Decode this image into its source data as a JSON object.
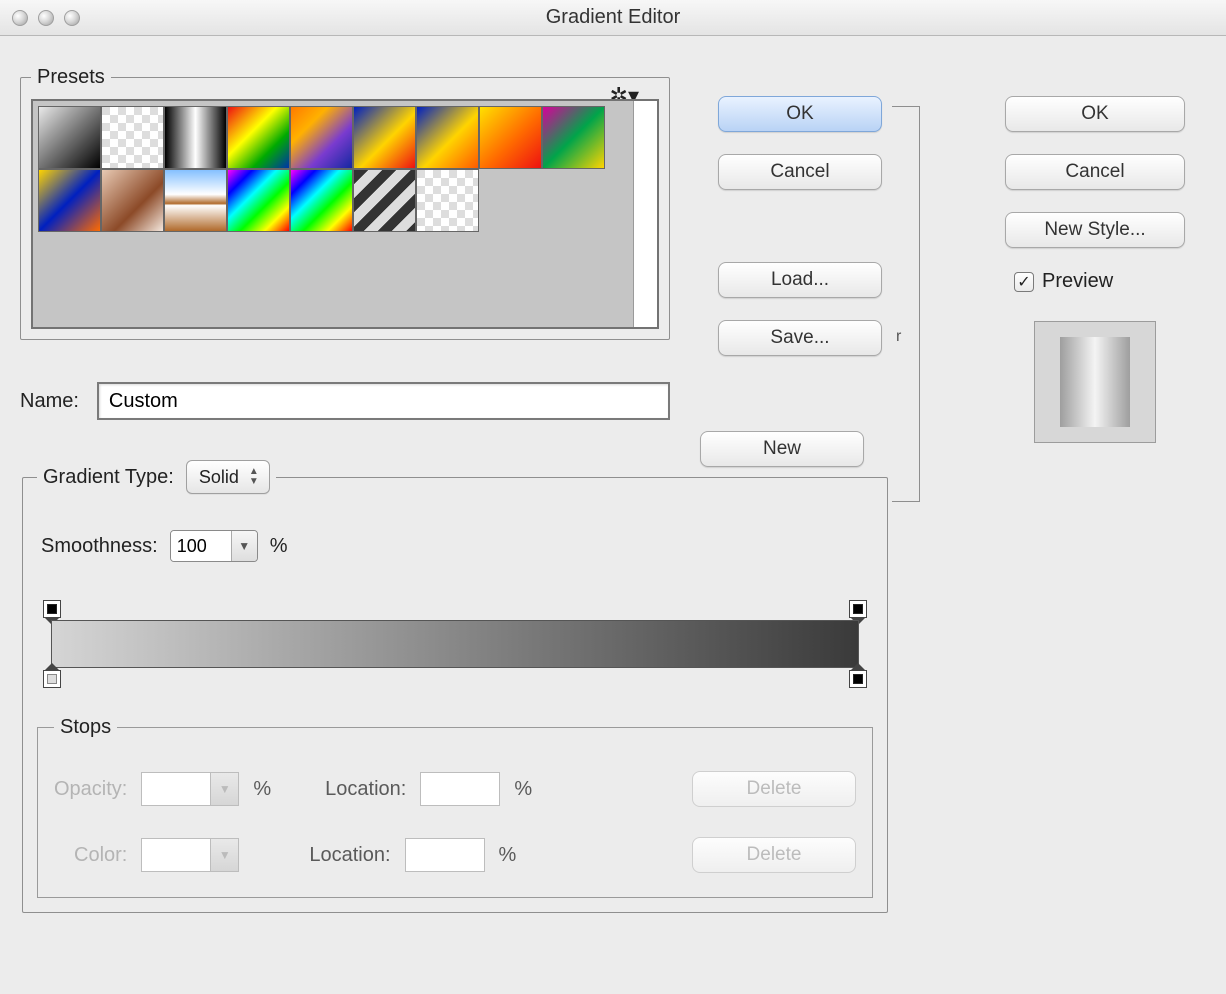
{
  "titlebar": {
    "title": "Gradient Editor"
  },
  "presets": {
    "legend": "Presets"
  },
  "name": {
    "label": "Name:",
    "value": "Custom"
  },
  "gradient_type": {
    "legend": "Gradient Type:",
    "selected": "Solid"
  },
  "smoothness": {
    "label": "Smoothness:",
    "value": "100",
    "unit": "%"
  },
  "stops": {
    "legend": "Stops",
    "opacity_label": "Opacity:",
    "opacity_unit": "%",
    "opacity_loc_label": "Location:",
    "opacity_loc_unit": "%",
    "opacity_delete": "Delete",
    "color_label": "Color:",
    "color_loc_label": "Location:",
    "color_loc_unit": "%",
    "color_delete": "Delete"
  },
  "mid_buttons": {
    "ok": "OK",
    "cancel": "Cancel",
    "load": "Load...",
    "save": "Save...",
    "new": "New"
  },
  "right_buttons": {
    "ok": "OK",
    "cancel": "Cancel",
    "new_style": "New Style..."
  },
  "preview": {
    "checkbox_label": "Preview"
  },
  "bracket_letter": "r"
}
